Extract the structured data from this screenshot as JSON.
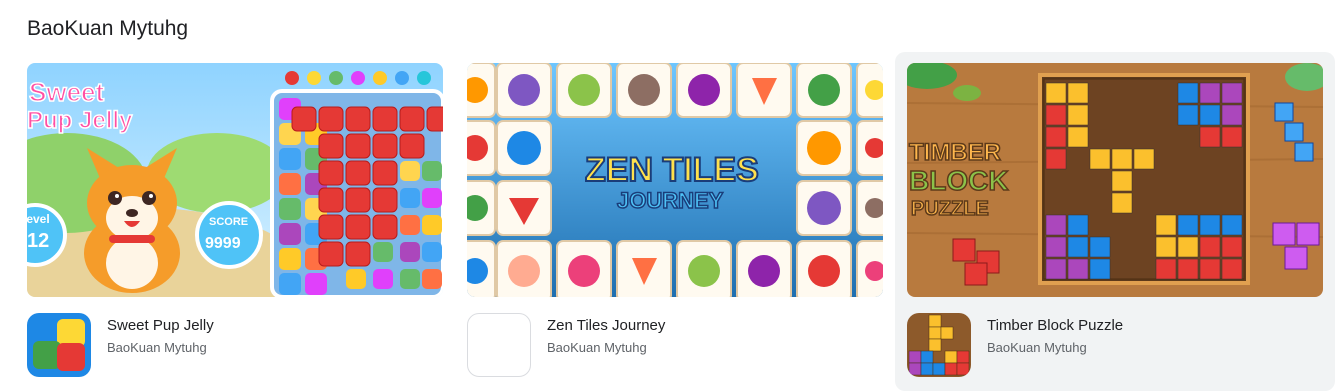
{
  "section": {
    "title": "BaoKuan Mytuhg"
  },
  "apps": [
    {
      "name": "Sweet Pup Jelly",
      "developer": "BaoKuan Mytuhg",
      "banner_text": {
        "title1": "Sweet",
        "title2": "Pup Jelly",
        "level_label": "Level",
        "level_value": "12",
        "score_label": "SCORE",
        "score_value": "9999"
      }
    },
    {
      "name": "Zen Tiles Journey",
      "developer": "BaoKuan Mytuhg",
      "banner_text": {
        "title1": "ZEN TILES",
        "title2": "JOURNEY"
      }
    },
    {
      "name": "Timber Block Puzzle",
      "developer": "BaoKuan Mytuhg",
      "banner_text": {
        "title1": "TIMBER",
        "title2": "BLOCK",
        "title3": "PUZZLE"
      }
    }
  ],
  "colors": {
    "hover_bg": "#f1f3f4",
    "title": "#202124",
    "subtitle": "#5f6368"
  }
}
